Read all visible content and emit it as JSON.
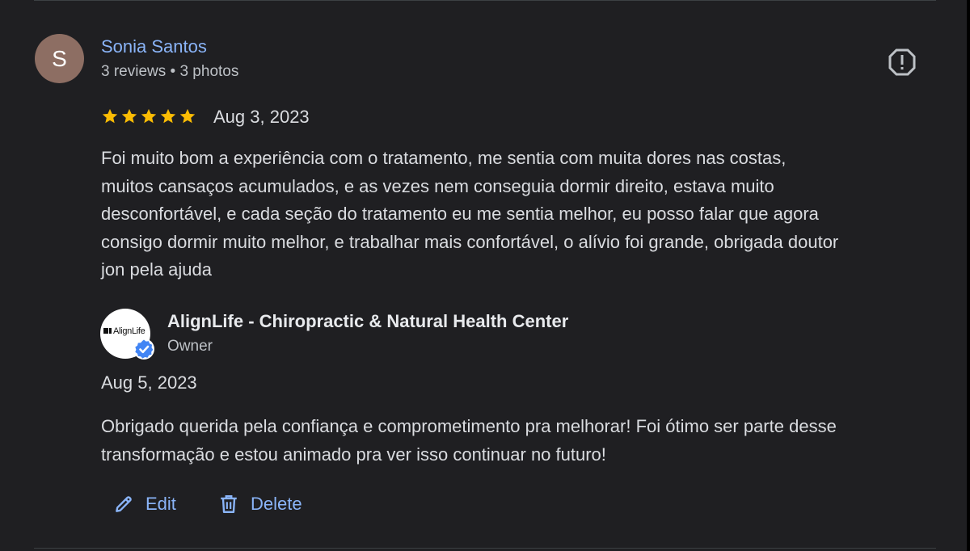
{
  "reviewer": {
    "avatar_letter": "S",
    "name": "Sonia Santos",
    "meta": "3 reviews • 3 photos"
  },
  "review": {
    "rating": 5,
    "date": "Aug 3, 2023",
    "lines": [
      "Foi muito bom a experiência com o tratamento, me sentia com muita dores nas costas,",
      "muitos cansaços acumulados, e as vezes nem conseguia dormir direito, estava muito",
      "desconfortável, e cada seção do tratamento eu me sentia melhor, eu posso falar que agora",
      "consigo dormir muito melhor, e trabalhar mais confortável, o alívio foi grande, obrigada doutor",
      "jon pela ajuda"
    ]
  },
  "owner_reply": {
    "logo_text": "AlignLife",
    "name": "AlignLife - Chiropractic & Natural Health Center",
    "role": "Owner",
    "date": "Aug 5, 2023",
    "lines": [
      "Obrigado querida pela confiança e comprometimento pra melhorar! Foi ótimo ser parte desse",
      "transformação e estou animado pra ver isso continuar no futuro!"
    ]
  },
  "actions": {
    "edit_label": "Edit",
    "delete_label": "Delete"
  },
  "icons": {
    "report": "report-flag-icon",
    "star": "star-icon",
    "verified": "verified-badge-icon",
    "edit": "pencil-icon",
    "delete": "trash-icon"
  },
  "colors": {
    "background": "#1f1f22",
    "link": "#8ab4f8",
    "star": "#fbbc04",
    "text": "#dadce0",
    "avatar": "#8d6e63",
    "verified": "#4285f4"
  }
}
